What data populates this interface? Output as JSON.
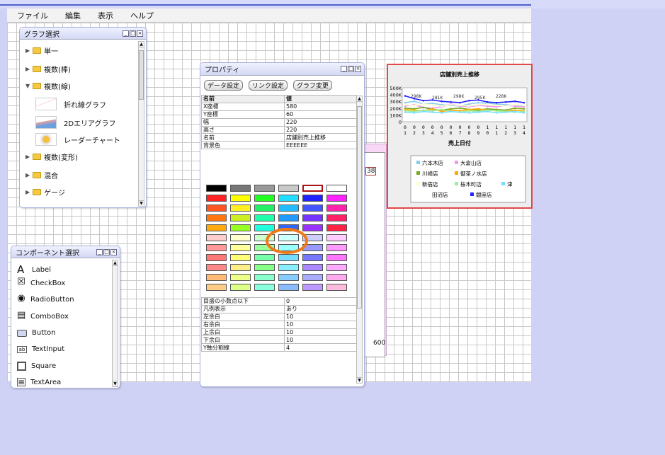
{
  "menu": [
    "ファイル",
    "編集",
    "表示",
    "ヘルプ"
  ],
  "graph_panel": {
    "title": "グラフ選択",
    "items": [
      {
        "label": "単一",
        "expanded": false
      },
      {
        "label": "複数(棒)",
        "expanded": false
      },
      {
        "label": "複数(線)",
        "expanded": true
      },
      {
        "label": "折れ線グラフ"
      },
      {
        "label": "2Dエリアグラフ"
      },
      {
        "label": "レーダーチャート"
      },
      {
        "label": "複数(変形)",
        "expanded": false
      },
      {
        "label": "混合",
        "expanded": false
      },
      {
        "label": "ゲージ",
        "expanded": false
      }
    ]
  },
  "component_panel": {
    "title": "コンポーネント選択",
    "items": [
      {
        "label": "Label",
        "icon": "label-icon",
        "glyph": "A"
      },
      {
        "label": "CheckBox",
        "icon": "checkbox-icon",
        "glyph": "☒"
      },
      {
        "label": "RadioButton",
        "icon": "radiobutton-icon",
        "glyph": "◉"
      },
      {
        "label": "ComboBox",
        "icon": "combobox-icon",
        "glyph": "▤"
      },
      {
        "label": "Button",
        "icon": "button-icon",
        "glyph": ""
      },
      {
        "label": "TextInput",
        "icon": "textinput-icon",
        "glyph": "ab"
      },
      {
        "label": "Square",
        "icon": "square-icon",
        "glyph": ""
      },
      {
        "label": "TextArea",
        "icon": "textarea-icon",
        "glyph": "≡"
      }
    ]
  },
  "property_panel": {
    "title": "プロパティ",
    "buttons": [
      "データ設定",
      "リンク設定",
      "グラフ変更"
    ],
    "header": [
      "名前",
      "値"
    ],
    "rows_top": [
      [
        "X座標",
        "580"
      ],
      [
        "Y座標",
        "60"
      ],
      [
        "幅",
        "220"
      ],
      [
        "高さ",
        "220"
      ],
      [
        "名前",
        "店舗別売上推移"
      ],
      [
        "背景色",
        "EEEEEE"
      ]
    ],
    "rows_bottom": [
      [
        "目盛の小数点以下",
        "0"
      ],
      [
        "凡例表示",
        "あり"
      ],
      [
        "左余白",
        "10"
      ],
      [
        "右余白",
        "10"
      ],
      [
        "上余白",
        "10"
      ],
      [
        "下余白",
        "10"
      ],
      [
        "Y軸分割線",
        "4"
      ]
    ]
  },
  "palette": {
    "rows": [
      [
        "#000000",
        "#777777",
        "#999999",
        "#c9c9c9",
        "#ffffff",
        "#ffffff"
      ],
      [
        "#ff2222",
        "#ffff00",
        "#22ff22",
        "#22ddff",
        "#2222ff",
        "#ff22ff"
      ],
      [
        "#ff5522",
        "#ffee22",
        "#22ee66",
        "#22bbff",
        "#4455ff",
        "#ff22aa"
      ],
      [
        "#ff7711",
        "#ccee22",
        "#22ffaa",
        "#2299ff",
        "#7733ff",
        "#ff2266"
      ],
      [
        "#ffaa11",
        "#99ff22",
        "#22ffdd",
        "#3366ff",
        "#9933ff",
        "#ff2244"
      ],
      [
        "#ffcccc",
        "#ffffcc",
        "#ccffcc",
        "#ccffff",
        "#ccccff",
        "#ffccff"
      ],
      [
        "#ff9999",
        "#ffff99",
        "#99ff99",
        "#99ffff",
        "#9999ff",
        "#ff99ff"
      ],
      [
        "#ff7777",
        "#ffff77",
        "#77ffaa",
        "#77ddff",
        "#7777ff",
        "#ff77ff"
      ],
      [
        "#ff8888",
        "#ffee88",
        "#88ff88",
        "#88eeff",
        "#aa88ff",
        "#ffaaff"
      ],
      [
        "#ffbb77",
        "#eeff88",
        "#88ffcc",
        "#88ccff",
        "#aaaaff",
        "#ffaaee"
      ],
      [
        "#ffcc88",
        "#ddff88",
        "#88ffdd",
        "#88bbff",
        "#bb99ff",
        "#ffbbdd"
      ]
    ],
    "selected": "#ffffff"
  },
  "bg_widget": {
    "label_38": "38",
    "label_600": "600"
  },
  "chart_data": {
    "type": "line",
    "title": "店舗別売上推移",
    "xlabel": "売上日付",
    "x": [
      "01",
      "02",
      "03",
      "04",
      "05",
      "06",
      "07",
      "08",
      "09",
      "10",
      "11",
      "12",
      "13",
      "14"
    ],
    "y_ticks": [
      "500K",
      "400K",
      "300K",
      "200K",
      "100K",
      "0"
    ],
    "ylim": [
      0,
      500000
    ],
    "series": [
      {
        "name": "六本木店",
        "color": "#88ccee",
        "values": [
          280000,
          300000,
          260000,
          270000,
          250000,
          240000,
          230000,
          260000,
          280000,
          270000,
          260000,
          250000,
          240000,
          230000
        ]
      },
      {
        "name": "大倉山店",
        "color": "#ee99ee",
        "values": [
          230000,
          250000,
          210000,
          200000,
          220000,
          260000,
          230000,
          220000,
          240000,
          230000,
          220000,
          240000,
          230000,
          220000
        ]
      },
      {
        "name": "川崎店",
        "color": "#77aa22",
        "values": [
          200000,
          190000,
          210000,
          180000,
          170000,
          190000,
          200000,
          180000,
          170000,
          190000,
          180000,
          170000,
          200000,
          190000
        ]
      },
      {
        "name": "御茶ノ水店",
        "color": "#ffaa00",
        "values": [
          180000,
          170000,
          160000,
          190000,
          150000,
          170000,
          160000,
          180000,
          190000,
          170000,
          160000,
          150000,
          170000,
          160000
        ]
      },
      {
        "name": "新宿店",
        "color": "#ffffcc",
        "values": [
          250000,
          240000,
          260000,
          250000,
          230000,
          250000,
          240000,
          230000,
          250000,
          260000,
          240000,
          230000,
          250000,
          240000
        ]
      },
      {
        "name": "桜木町店",
        "color": "#99ee99",
        "values": [
          160000,
          150000,
          170000,
          160000,
          180000,
          150000,
          140000,
          160000,
          150000,
          170000,
          160000,
          150000,
          140000,
          150000
        ]
      },
      {
        "name": "津田沼店",
        "color": "#77ddff",
        "values": [
          140000,
          130000,
          150000,
          140000,
          130000,
          150000,
          140000,
          130000,
          140000,
          150000,
          130000,
          140000,
          150000,
          130000
        ]
      },
      {
        "name": "銀座店",
        "color": "#2222ff",
        "values": [
          380000,
          340000,
          310000,
          320000,
          300000,
          290000,
          280000,
          310000,
          320000,
          290000,
          280000,
          290000,
          300000,
          280000
        ]
      }
    ],
    "legend_labels": [
      "六本木店",
      "大倉山店",
      "川崎店",
      "御茶ノ水店",
      "新宿店",
      "桜木町店",
      "津",
      "田沼店",
      "銀座店"
    ],
    "data_labels": [
      "298K",
      "281K",
      "298K",
      "295K",
      "228K"
    ],
    "legend_position": "bottom"
  }
}
